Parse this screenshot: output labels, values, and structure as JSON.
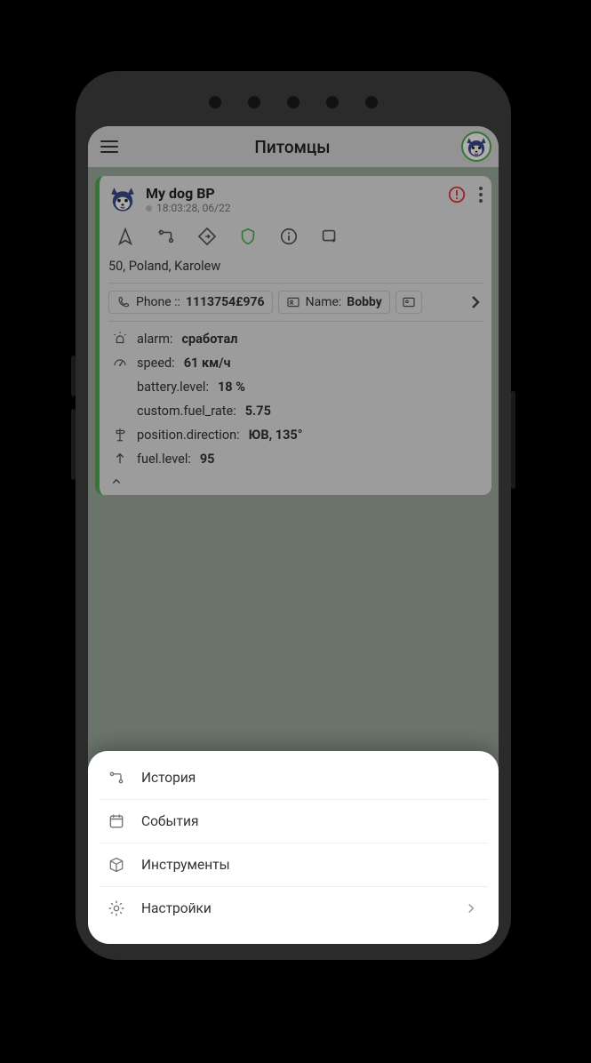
{
  "header": {
    "title": "Питомцы"
  },
  "pet": {
    "name": "My dog BP",
    "timestamp": "18:03:28, 06/22",
    "address": "50, Poland, Karolew"
  },
  "chips": {
    "phone_label": "Phone ::",
    "phone_value": "1113754£976",
    "name_label": "Name:",
    "name_value": "Bobby"
  },
  "sensors": {
    "alarm_label": "alarm:",
    "alarm_value": "сработал",
    "speed_label": "speed:",
    "speed_value": "61 км/ч",
    "battery_label": "battery.level:",
    "battery_value": "18 %",
    "fuelrate_label": "custom.fuel_rate:",
    "fuelrate_value": "5.75",
    "direction_label": "position.direction:",
    "direction_value": "ЮВ, 135°",
    "fuellevel_label": "fuel.level:",
    "fuellevel_value": "95"
  },
  "menu": {
    "history": "История",
    "events": "События",
    "tools": "Инструменты",
    "settings": "Настройки"
  }
}
